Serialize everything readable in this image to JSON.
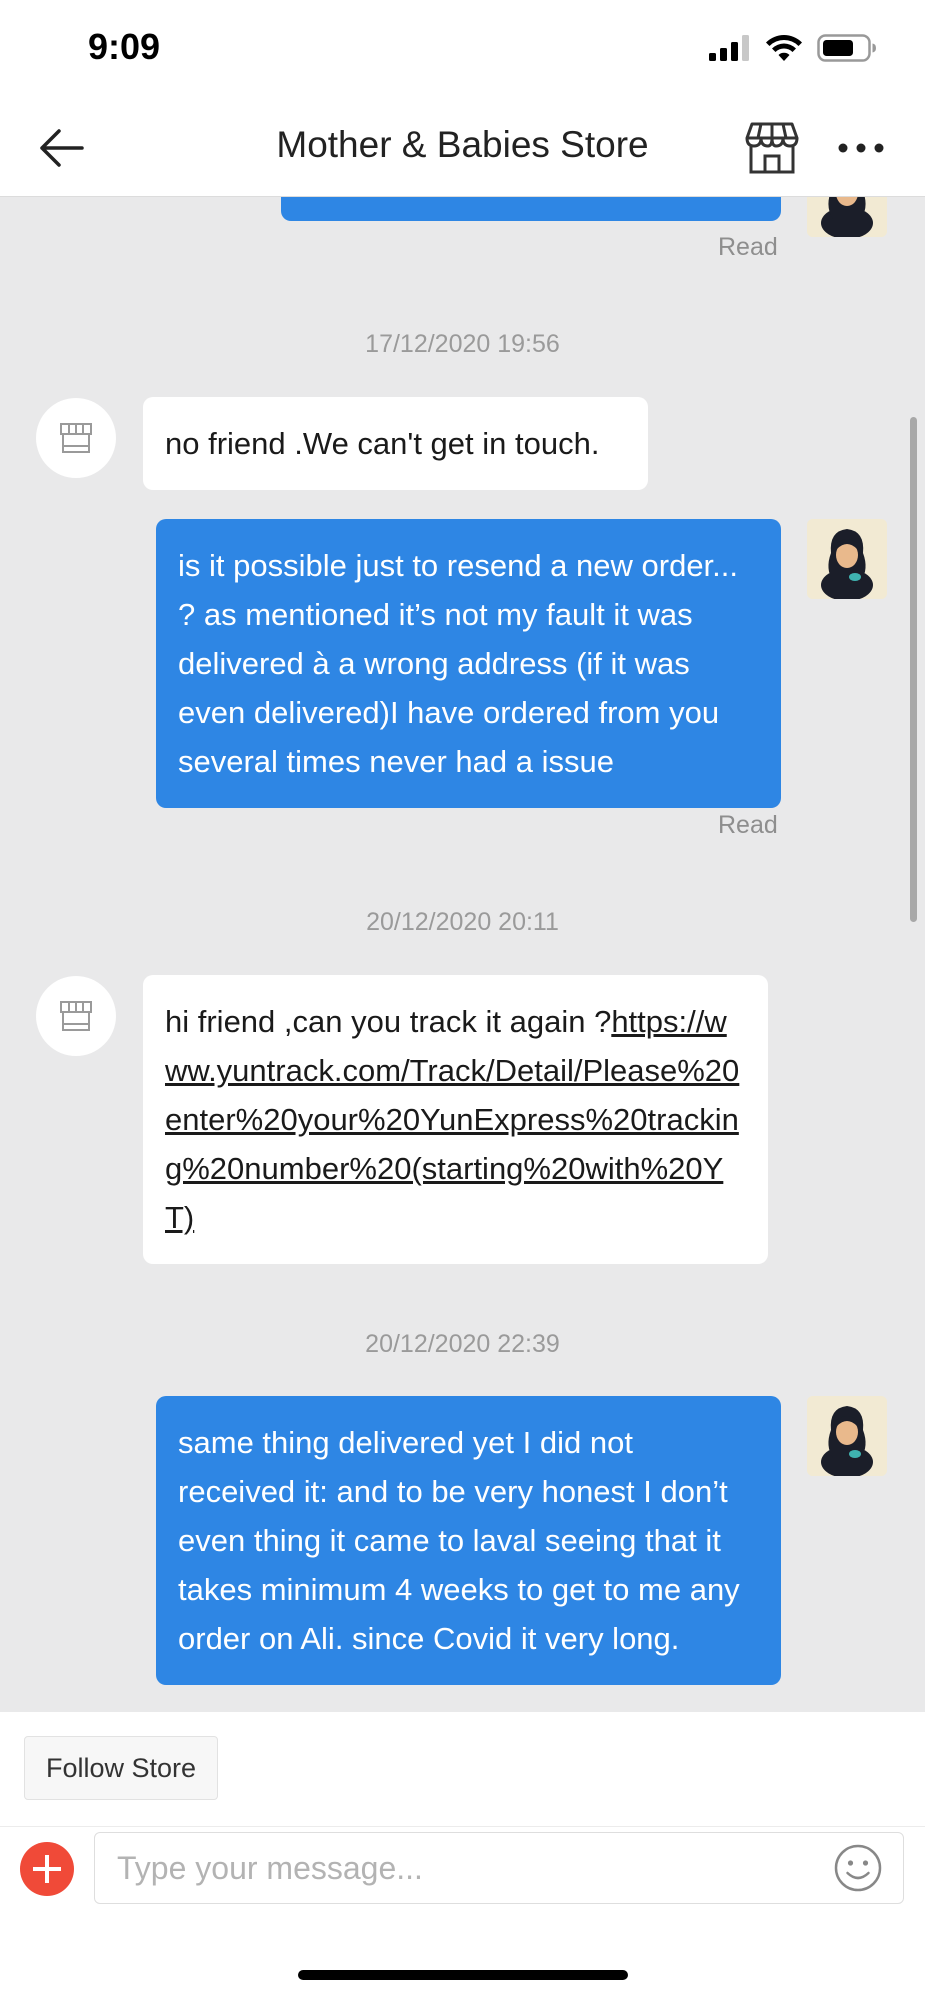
{
  "status_bar": {
    "time": "9:09"
  },
  "nav": {
    "title": "Mother & Babies Store"
  },
  "messages": {
    "top_read": "Read",
    "ts1": "17/12/2020 19:56",
    "store_msg1": "no friend .We can't get in touch.",
    "user_msg1": "is it possible just to resend a new order... ?  as mentioned it’s not my fault it was delivered à a wrong address (if it was even delivered)I have ordered from you several  times never had a issue",
    "read1": "Read",
    "ts2": "20/12/2020 20:11",
    "store_msg2_prefix": "hi friend ,can you track it again ?",
    "store_msg2_link": "https://www.yuntrack.com/Track/Detail/Please%20enter%20your%20YunExpress%20tracking%20number%20(starting%20with%20YT)",
    "ts3": "20/12/2020 22:39",
    "user_msg2": "same thing delivered yet I did not received it: and to be very honest I don’t even thing it came to laval seeing that it takes minimum 4 weeks to get to me any order on Ali. since Covid it very long."
  },
  "bottom": {
    "follow_label": "Follow Store",
    "input_placeholder": "Type your message..."
  },
  "colors": {
    "bubble_mine": "#2e86e4",
    "bubble_theirs": "#ffffff",
    "plus_button": "#f04a38",
    "background": "#e9e9ea"
  },
  "icons": [
    "back-arrow-icon",
    "store-icon",
    "more-icon",
    "plus-icon",
    "emoji-icon",
    "store-avatar-icon",
    "signal-icon",
    "wifi-icon",
    "battery-icon"
  ]
}
